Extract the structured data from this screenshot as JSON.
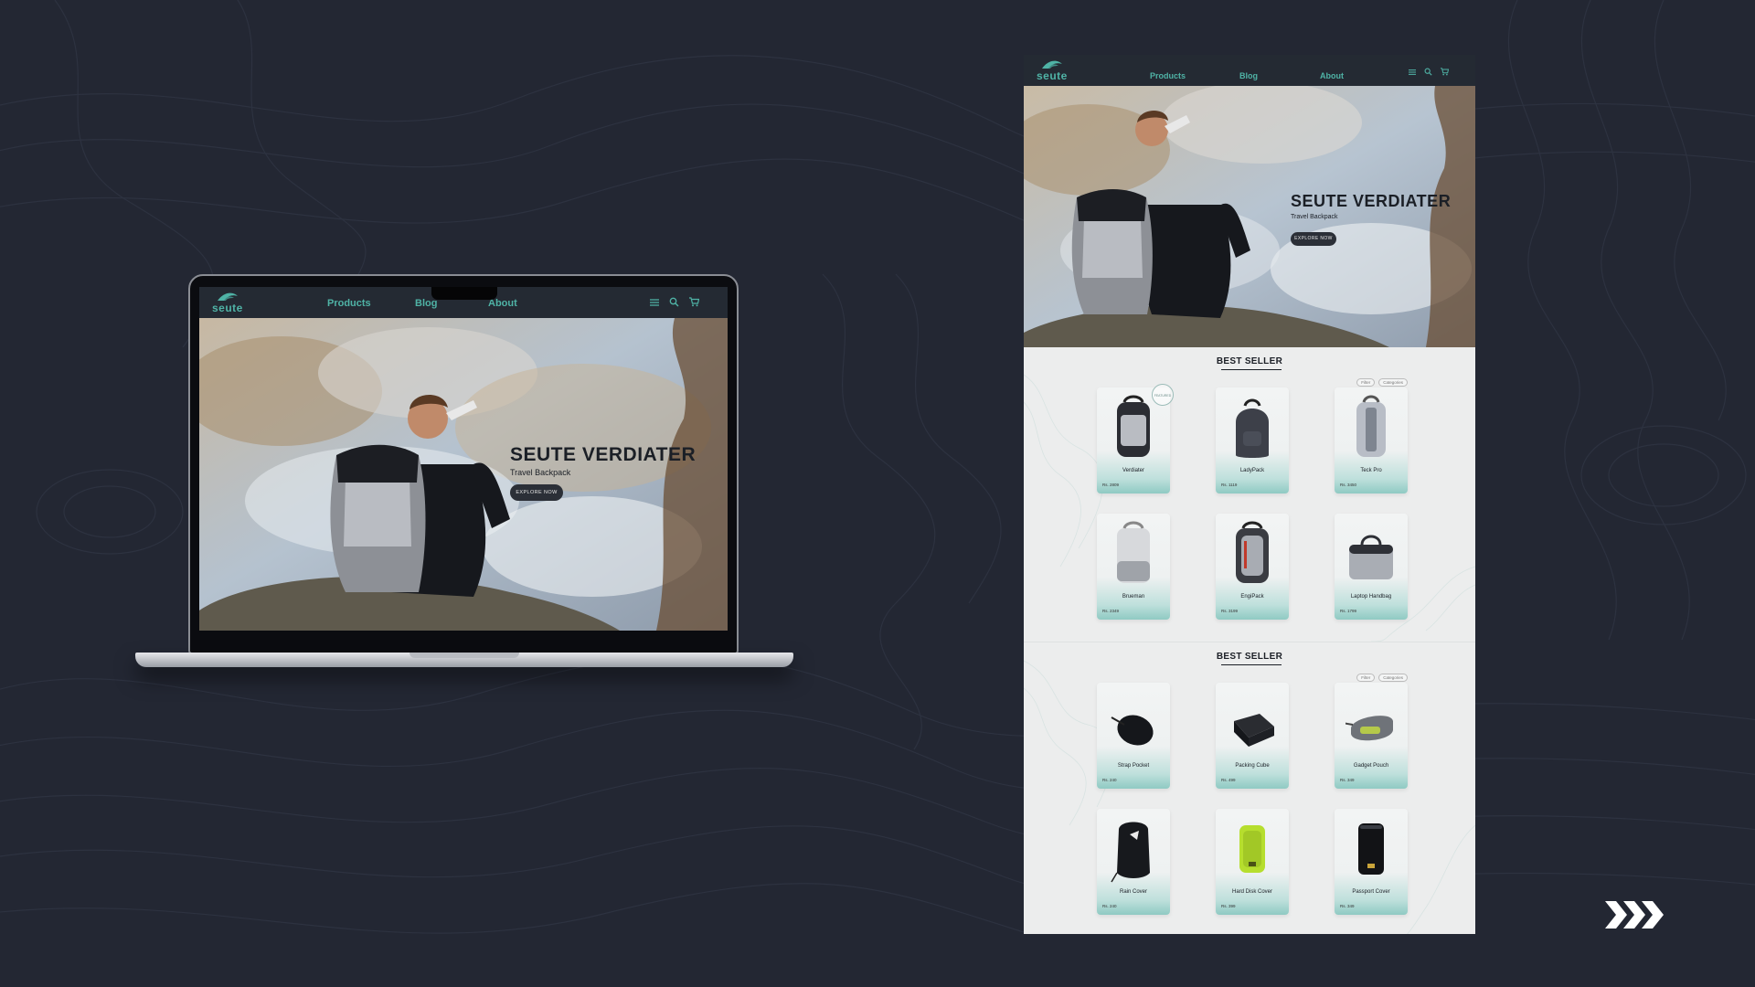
{
  "site": {
    "logo": "seute",
    "nav": {
      "products": "Products",
      "blog": "Blog",
      "about": "About"
    },
    "icons": [
      "menu-icon",
      "search-icon",
      "cart-icon"
    ],
    "accent_color": "#4fb3a6",
    "nav_background": "#242a33"
  },
  "hero": {
    "title": "SEUTE VERDIATER",
    "subtitle": "Travel Backpack",
    "cta": "EXPLORE NOW"
  },
  "sections": [
    {
      "title": "BEST SELLER",
      "filters": [
        "Filter",
        "Categories"
      ],
      "badge": "FEATURED",
      "products": [
        {
          "name": "Verdiater",
          "price": "Rs. 2809"
        },
        {
          "name": "LadyPack",
          "price": "Rs. 1119"
        },
        {
          "name": "Teck Pro",
          "price": "Rs. 3450"
        },
        {
          "name": "Brueman",
          "price": "Rs. 2349"
        },
        {
          "name": "EngiPack",
          "price": "Rs. 3199"
        },
        {
          "name": "Laptop Handbag",
          "price": "Rs. 1799"
        }
      ]
    },
    {
      "title": "BEST SELLER",
      "filters": [
        "Filter",
        "Categories"
      ],
      "products": [
        {
          "name": "Strap Pocket",
          "price": "Rs. 240"
        },
        {
          "name": "Packing Cube",
          "price": "Rs. 499"
        },
        {
          "name": "Gadget Pouch",
          "price": "Rs. 349"
        },
        {
          "name": "Rain Cover",
          "price": "Rs. 240"
        },
        {
          "name": "Hard Disk Cover",
          "price": "Rs. 399"
        },
        {
          "name": "Passport Cover",
          "price": "Rs. 349"
        }
      ]
    }
  ],
  "background_color": "#232733"
}
